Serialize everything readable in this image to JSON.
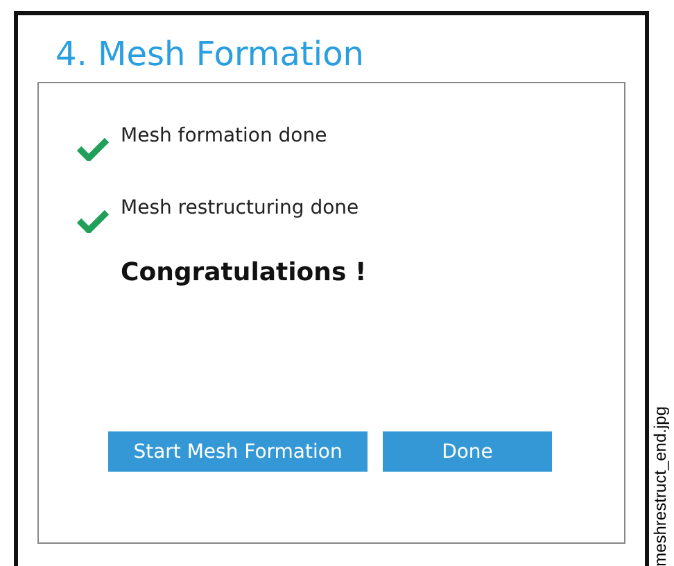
{
  "dialog": {
    "title": "4. Mesh Formation"
  },
  "steps": [
    {
      "label": "Mesh formation done",
      "done": true
    },
    {
      "label": "Mesh restructuring done",
      "done": true
    }
  ],
  "message": "Congratulations !",
  "buttons": [
    {
      "label": "Start Mesh Formation"
    },
    {
      "label": "Done"
    }
  ],
  "side_caption": "meshrestruct_end.jpg"
}
